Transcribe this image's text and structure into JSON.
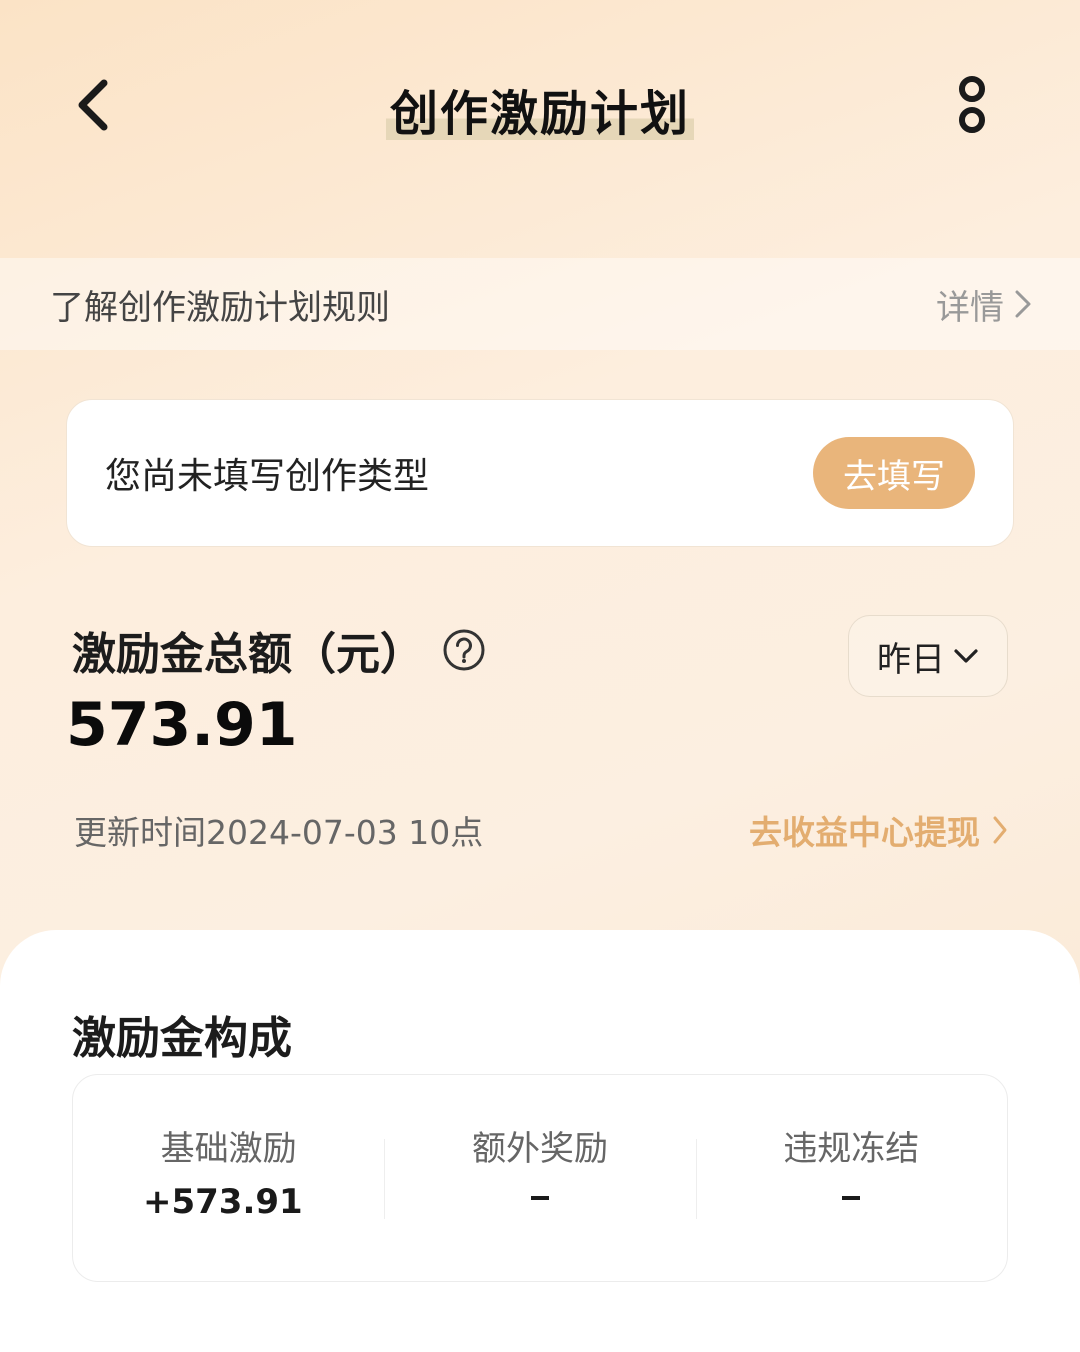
{
  "header": {
    "title": "创作激励计划",
    "back_icon": "chevron-left-icon",
    "more_icon": "vertical-dots-icon"
  },
  "rules_bar": {
    "text": "了解创作激励计划规则",
    "link_label": "详情"
  },
  "type_card": {
    "text": "您尚未填写创作类型",
    "button_label": "去填写"
  },
  "total": {
    "label": "激励金总额（元）",
    "value": "573.91",
    "period": "昨日",
    "update_time": "更新时间2024-07-03 10点",
    "withdraw_label": "去收益中心提现"
  },
  "composition": {
    "title": "激励金构成",
    "items": [
      {
        "label": "基础激励",
        "value": "+573.91"
      },
      {
        "label": "额外奖励",
        "value": "-"
      },
      {
        "label": "违规冻结",
        "value": "-"
      }
    ]
  },
  "colors": {
    "accent": "#e9b57b",
    "link": "#e3ad70",
    "background_top": "#fbe3c6"
  }
}
